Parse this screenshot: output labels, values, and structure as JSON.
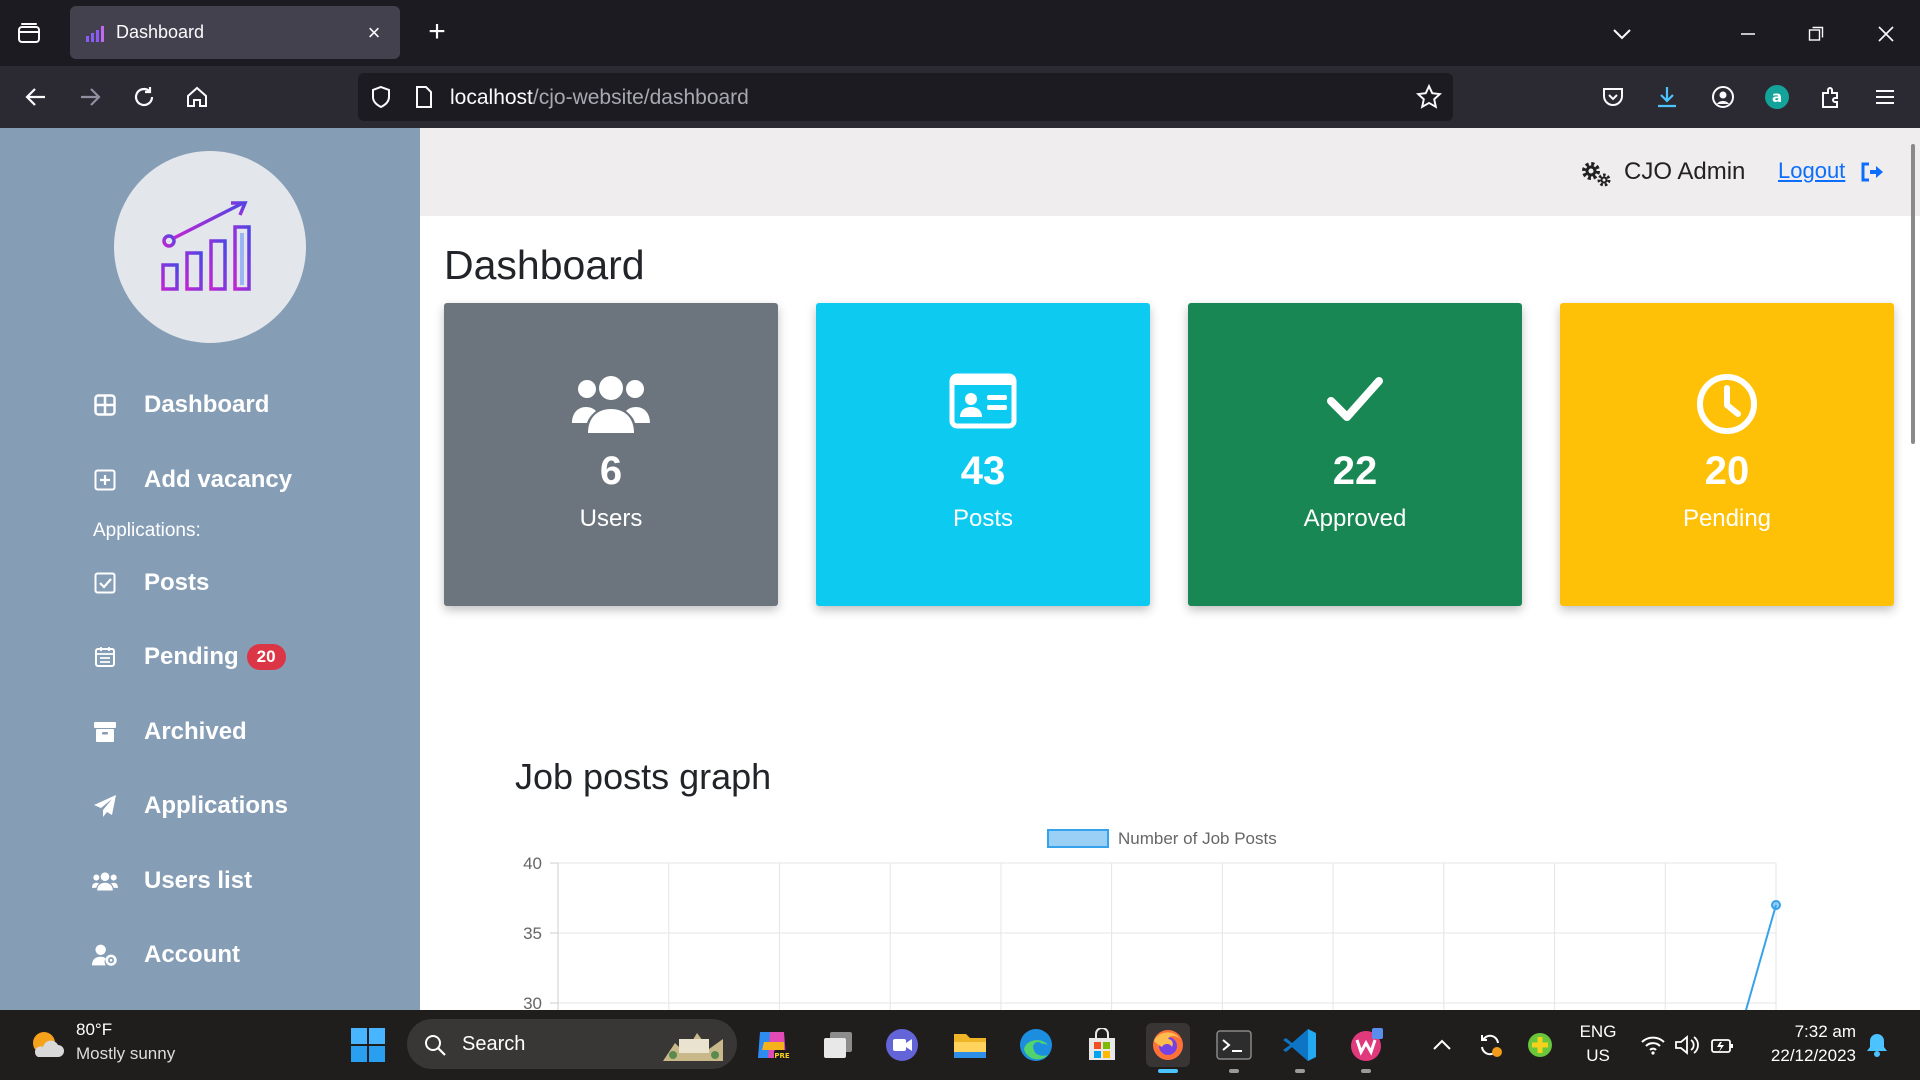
{
  "browser": {
    "tab_title": "Dashboard",
    "url_host": "localhost",
    "url_path": "/cjo-website/dashboard"
  },
  "header": {
    "admin_name": "CJO Admin",
    "logout_label": "Logout"
  },
  "sidebar": {
    "items": [
      {
        "label": "Dashboard",
        "icon": "grid-icon"
      },
      {
        "label": "Add vacancy",
        "icon": "plus-square-icon"
      },
      {
        "label": "Posts",
        "icon": "check-square-icon"
      },
      {
        "label": "Pending",
        "icon": "calendar-list-icon",
        "badge": "20"
      },
      {
        "label": "Archived",
        "icon": "archive-box-icon"
      },
      {
        "label": "Applications",
        "icon": "paper-plane-icon"
      },
      {
        "label": "Users list",
        "icon": "users-icon"
      },
      {
        "label": "Account",
        "icon": "user-gear-icon"
      }
    ],
    "section_heading": "Applications:"
  },
  "main": {
    "title": "Dashboard",
    "cards": [
      {
        "value": "6",
        "label": "Users",
        "color": "#6c757d",
        "icon": "users-icon"
      },
      {
        "value": "43",
        "label": "Posts",
        "color": "#0dcaf0",
        "icon": "id-card-icon"
      },
      {
        "value": "22",
        "label": "Approved",
        "color": "#198754",
        "icon": "check-icon"
      },
      {
        "value": "20",
        "label": "Pending",
        "color": "#ffc107",
        "icon": "clock-icon"
      }
    ],
    "graph_title": "Job posts graph"
  },
  "chart_data": {
    "type": "line",
    "title": "",
    "legend": [
      "Number of Job Posts"
    ],
    "series": [
      {
        "name": "Number of Job Posts",
        "visible_last_point": 37
      }
    ],
    "ylabel": "",
    "xlabel": "",
    "y_ticks": [
      40,
      35,
      30
    ],
    "ylim_visible": [
      30,
      40
    ],
    "x_gridlines": 12,
    "line_color": "#36a2eb"
  },
  "taskbar": {
    "weather_temp": "80°F",
    "weather_desc": "Mostly sunny",
    "search_label": "Search",
    "lang_line1": "ENG",
    "lang_line2": "US",
    "time": "7:32 am",
    "date": "22/12/2023"
  }
}
